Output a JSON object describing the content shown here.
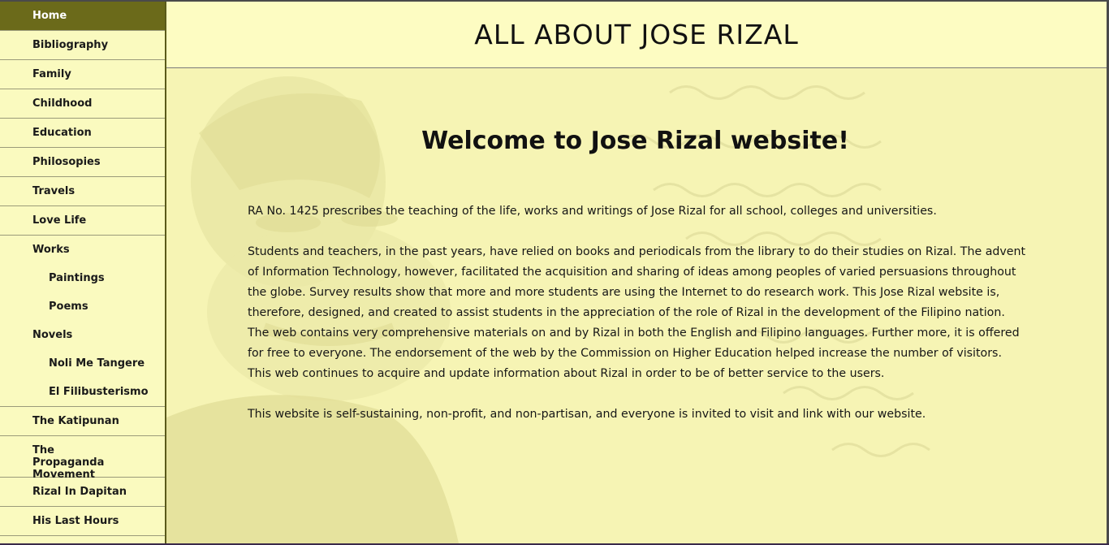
{
  "sidebar": {
    "items": [
      {
        "label": "Home"
      },
      {
        "label": "Bibliography"
      },
      {
        "label": "Family"
      },
      {
        "label": "Childhood"
      },
      {
        "label": "Education"
      },
      {
        "label": "Philosopies"
      },
      {
        "label": "Travels"
      },
      {
        "label": "Love Life"
      },
      {
        "label": "Works"
      },
      {
        "label": "Paintings"
      },
      {
        "label": "Poems"
      },
      {
        "label": "Novels"
      },
      {
        "label": "Noli Me Tangere"
      },
      {
        "label": "El Filibusterismo"
      },
      {
        "label": "The Katipunan"
      },
      {
        "label": "The Propaganda Movement"
      },
      {
        "label": "Rizal In Dapitan"
      },
      {
        "label": "His Last Hours"
      }
    ]
  },
  "header": {
    "title": "ALL ABOUT JOSE RIZAL"
  },
  "main": {
    "welcome": "Welcome to Jose Rizal website!",
    "paragraphs": [
      "RA No. 1425 prescribes the teaching of the life, works and writings of Jose Rizal for all school, colleges and universities.",
      "Students and teachers, in the past years, have relied on books and periodicals from the library to do their studies on Rizal. The advent of Information Technology, however, facilitated the acquisition and sharing of ideas among peoples of varied persuasions throughout the globe. Survey results show that more and more students are using the Internet to do research work. This Jose Rizal website is, therefore, designed, and created to assist students in the appreciation of the role of Rizal in the development of the Filipino nation. The web contains very comprehensive materials on and by Rizal in both the English and Filipino languages. Further more, it is offered for free to everyone. The endorsement of the web by the Commission on Higher Education helped increase the number of visitors. This web continues to acquire and update information about Rizal in order to be of better service to the users.",
      "This website is self-sustaining, non-profit, and non-partisan, and everyone is invited to visit and link with our website."
    ]
  },
  "colors": {
    "active_nav": "#6b6a1a",
    "background": "#fdfcc2",
    "content_bg": "#f6f4b4"
  }
}
